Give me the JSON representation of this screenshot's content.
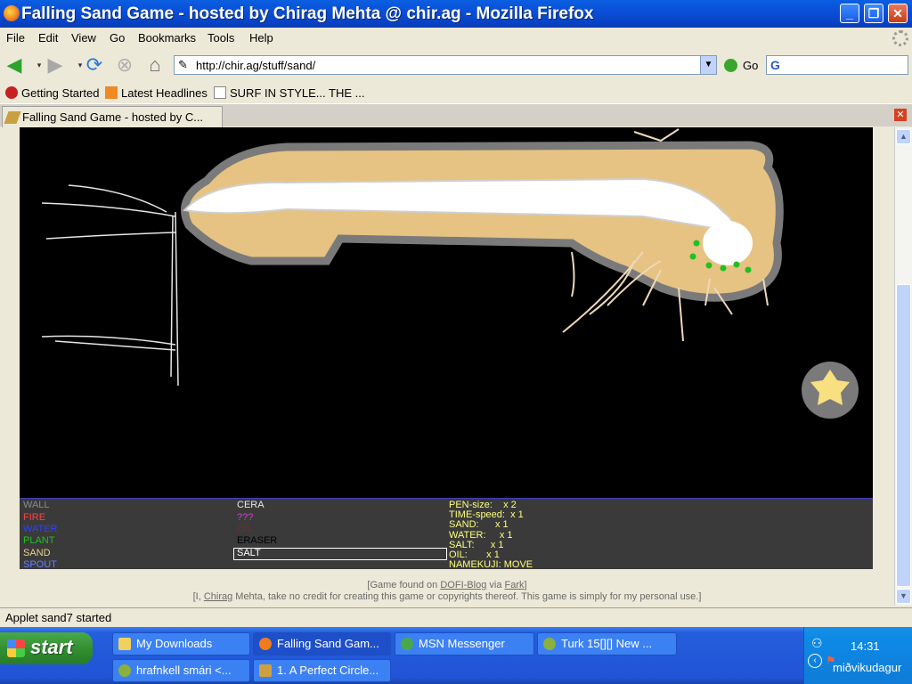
{
  "window": {
    "title": "Falling Sand Game - hosted by Chirag Mehta @ chir.ag - Mozilla Firefox",
    "minimize": "_",
    "maximize": "❐",
    "close": "✕"
  },
  "menu": [
    "File",
    "Edit",
    "View",
    "Go",
    "Bookmarks",
    "Tools",
    "Help"
  ],
  "nav": {
    "url": "http://chir.ag/stuff/sand/",
    "go_label": "Go",
    "search_placeholder": ""
  },
  "bookmarks": [
    "Getting Started",
    "Latest Headlines",
    "SURF IN STYLE... THE ..."
  ],
  "tab": {
    "label": "Falling Sand Game - hosted by C..."
  },
  "game": {
    "elements_col1": [
      {
        "label": "WALL",
        "color": "#8a8a8a"
      },
      {
        "label": "FIRE",
        "color": "#ff4040"
      },
      {
        "label": "WATER",
        "color": "#3040ff"
      },
      {
        "label": "PLANT",
        "color": "#20c020"
      },
      {
        "label": "SAND",
        "color": "#eed28c"
      },
      {
        "label": "SPOUT",
        "color": "#6a7cff"
      }
    ],
    "elements_col2": [
      {
        "label": "CERA",
        "color": "#e8e8e8"
      },
      {
        "label": "???",
        "color": "#d040d0"
      },
      {
        "label": "OIL",
        "color": "#6a3030"
      },
      {
        "label": "ERASER",
        "color": "#000000"
      },
      {
        "label": "SALT",
        "color": "#ffffff"
      }
    ],
    "selected": "SALT",
    "stats": [
      "PEN-size:    x 2",
      "TIME-speed:  x 1",
      "SAND:      x 1",
      "WATER:     x 1",
      "SALT:      x 1",
      "OIL:       x 1",
      "NAMEKUJI: MOVE"
    ],
    "stats_color": "#ffff80"
  },
  "credits": {
    "line1_pre": "[Game found on ",
    "line1_link1": "DOFI-Blog",
    "line1_mid": " via ",
    "line1_link2": "Fark",
    "line1_post": "]",
    "line2_pre": "[I, ",
    "line2_link": "Chirag",
    "line2_post": " Mehta, take no credit for creating this game or copyrights thereof. This game is simply for my personal use.]"
  },
  "status": "Applet sand7 started",
  "taskbar": {
    "start": "start",
    "row1": [
      {
        "label": "My Downloads",
        "active": false
      },
      {
        "label": "Falling Sand Gam...",
        "active": true
      },
      {
        "label": "MSN Messenger",
        "active": false
      },
      {
        "label": "Turk 15[][] New ...",
        "active": false
      }
    ],
    "row2": [
      {
        "label": "hrafnkell smári <...",
        "active": false
      },
      {
        "label": "1. A Perfect Circle...",
        "active": false
      }
    ],
    "clock": "14:31",
    "day": "miðvikudagur"
  }
}
